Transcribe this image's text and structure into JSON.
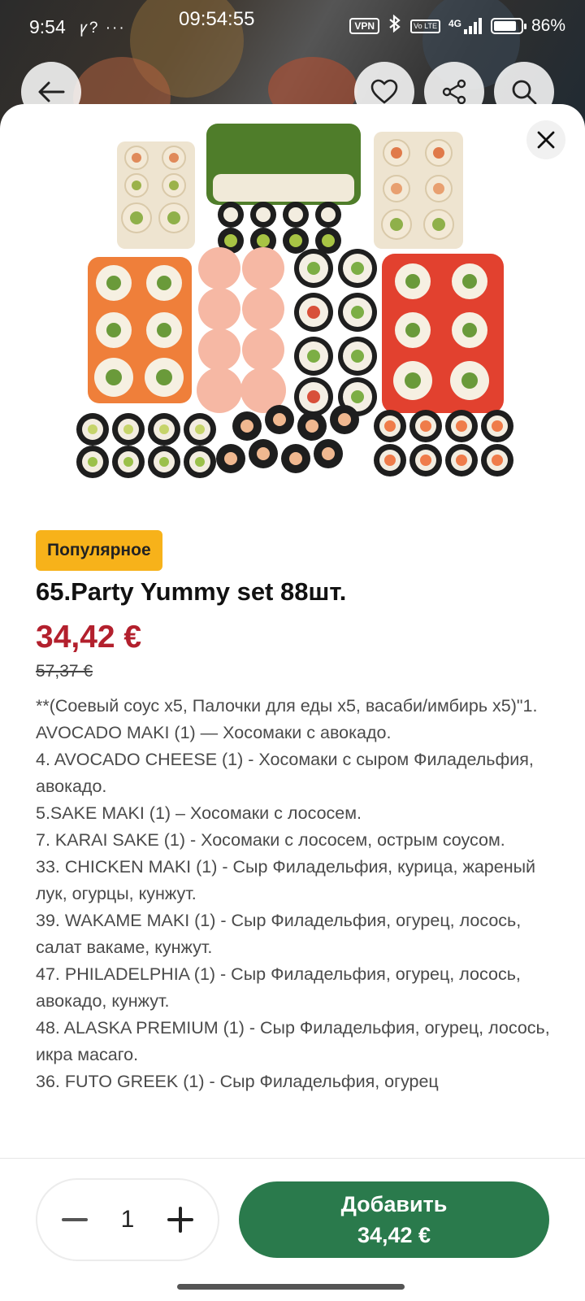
{
  "status_bar": {
    "time": "9:54",
    "mini_icons": "ꝩ? ···",
    "clock": "09:54:55",
    "vpn": "VPN",
    "volte": "Vo LTE",
    "network": "4G",
    "battery": "86%",
    "battery_level": 0.86
  },
  "sheet": {
    "badge": "Популярное",
    "title": "65.Party Yummy set 88шт.",
    "price": "34,42 €",
    "old_price": "57,37 €",
    "description": [
      "**(Соевый соус х5, Палочки для еды х5, васаби/имбирь х5)\"1. AVOCADO MAKI (1) — Хосомаки с авокадо.",
      "4. AVOCADO CHEESE (1) - Хосомаки с сыром Филадельфия, авокадо.",
      "5.SAKE MAKI (1) – Хосомаки с лососем.",
      "7. KARAI SAKE (1) - Хосомаки с лососем, острым соусом.",
      "33. CHICKEN MAKI (1) - Сыр Филадельфия, курица, жареный лук, огурцы, кунжут.",
      "39. WAKAME MAKI (1) - Сыр Филадельфия, огурец, лосось, салат вакаме, кунжут.",
      "47. PHILADELPHIA (1) - Сыр Филадельфия, огурец, лосось, авокадо, кунжут.",
      "48. ALASKA PREMIUM (1) - Сыр Филадельфия, огурец, лосось, икра масаго.",
      "36. FUTO GREEK (1) - Сыр Филадельфия, огурец"
    ]
  },
  "bottom_bar": {
    "quantity": "1",
    "add_label": "Добавить",
    "add_price": "34,42 €"
  },
  "icons": {
    "back": "arrow-left-icon",
    "favorite": "heart-icon",
    "share": "share-icon",
    "search": "search-icon",
    "close": "close-icon",
    "minus": "minus-icon",
    "plus": "plus-icon"
  },
  "colors": {
    "price": "#b3202d",
    "badge": "#f7b21a",
    "add_button": "#2a7a4c"
  }
}
